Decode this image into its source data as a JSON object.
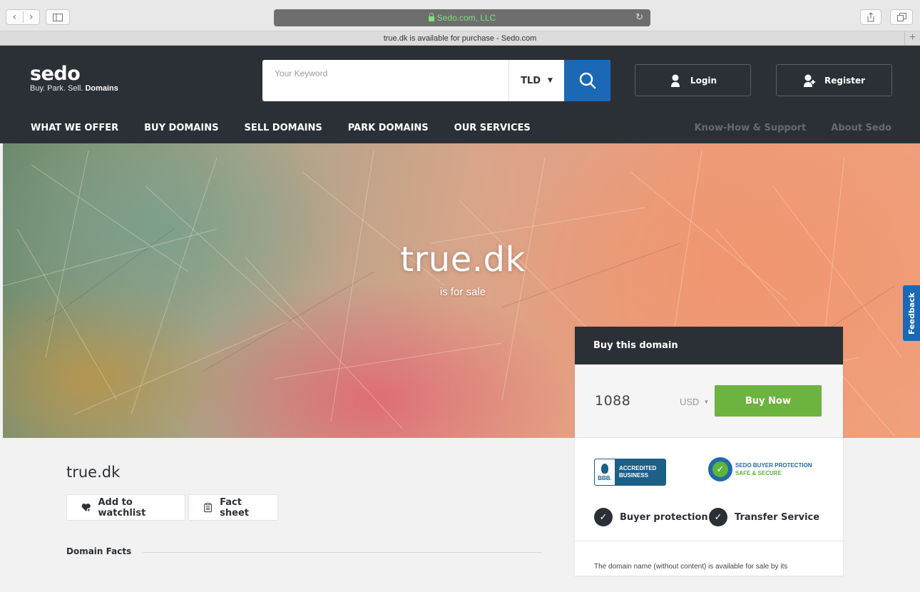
{
  "browser": {
    "address": "Sedo.com, LLC",
    "tab_title": "true.dk is available for purchase - Sedo.com",
    "nav_back": "‹",
    "nav_forward": "›",
    "new_tab": "+"
  },
  "header": {
    "logo_word": "sedo",
    "logo_tagline_plain": "Buy. Park. Sell. ",
    "logo_tagline_bold": "Domains",
    "search_placeholder": "Your Keyword",
    "tld_label": "TLD",
    "login_label": "Login",
    "register_label": "Register",
    "main_nav": [
      "WHAT WE OFFER",
      "BUY DOMAINS",
      "SELL DOMAINS",
      "PARK DOMAINS",
      "OUR SERVICES"
    ],
    "sub_nav": [
      "Know-How & Support",
      "About Sedo"
    ]
  },
  "hero": {
    "title": "true.dk",
    "subtitle": "is for sale"
  },
  "buybox": {
    "heading": "Buy this domain",
    "price": "1088",
    "currency": "USD",
    "buy_label": "Buy Now",
    "bbb_line1": "ACCREDITED",
    "bbb_line2": "BUSINESS",
    "bbb_seal": "BBB.",
    "protection_line1": "SEDO BUYER PROTECTION",
    "protection_line2": "SAFE & SECURE",
    "feature_1": "Buyer protection",
    "feature_2": "Transfer Service",
    "description": "The domain name (without content) is available for sale by its"
  },
  "feedback_label": "Feedback",
  "content": {
    "domain_name": "true.dk",
    "watchlist_label": "Add to watchlist",
    "factsheet_label": "Fact sheet",
    "facts_heading": "Domain Facts"
  },
  "colors": {
    "header_bg": "#2b3037",
    "accent_blue": "#1b69b6",
    "buy_green": "#6db33f"
  }
}
